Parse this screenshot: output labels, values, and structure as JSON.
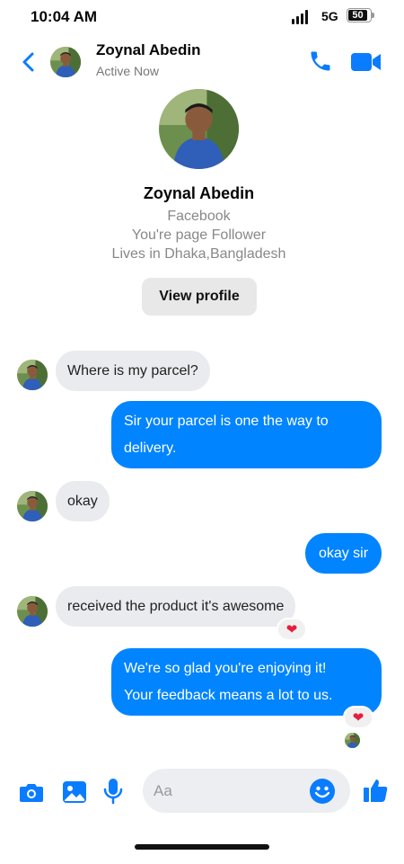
{
  "status_bar": {
    "time": "10:04 AM",
    "network": "5G",
    "battery": "50"
  },
  "header": {
    "name": "Zoynal Abedin",
    "status": "Active Now"
  },
  "profile": {
    "name": "Zoynal Abedin",
    "line1": "Facebook",
    "line2": "You're page Follower",
    "line3": "Lives in Dhaka,Bangladesh",
    "view_profile_label": "View profile"
  },
  "messages": [
    {
      "from": "them",
      "text": "Where is my parcel?"
    },
    {
      "from": "me",
      "text1": "Sir your parcel is one the way to",
      "text2": "delivery."
    },
    {
      "from": "them",
      "text": "okay"
    },
    {
      "from": "me",
      "text": "okay sir"
    },
    {
      "from": "them",
      "text": "received the product it's awesome",
      "reaction": "❤"
    },
    {
      "from": "me",
      "text1": "We're so glad you're enjoying it!",
      "text2": "Your feedback means a lot to us.",
      "reaction": "❤"
    }
  ],
  "composer": {
    "placeholder": "Aa"
  },
  "colors": {
    "accent": "#0084ff",
    "incoming_bubble": "#e9ebee",
    "reaction_heart": "#e41e3f"
  },
  "icons": [
    "back-arrow-icon",
    "phone-icon",
    "video-camera-icon",
    "camera-icon",
    "gallery-icon",
    "microphone-icon",
    "emoji-icon",
    "like-thumb-icon"
  ]
}
